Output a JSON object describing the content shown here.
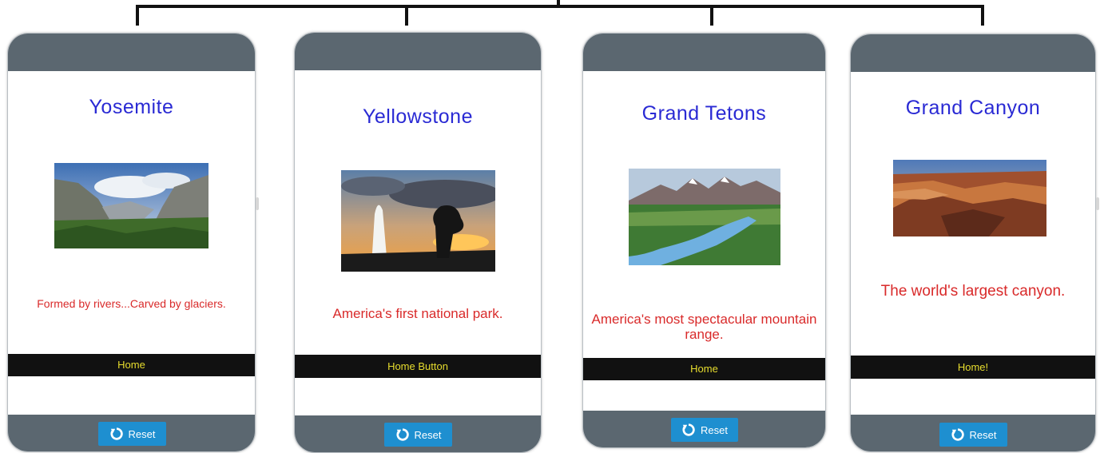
{
  "screens": [
    {
      "title": "Yosemite",
      "caption": "Formed by rivers...Carved by glaciers.",
      "home_label": "Home",
      "reset_label": "Reset",
      "image_icon": "yosemite-valley-photo"
    },
    {
      "title": "Yellowstone",
      "caption": "America's first national park.",
      "home_label": "Home Button",
      "reset_label": "Reset",
      "image_icon": "geyser-sunset-photo"
    },
    {
      "title": "Grand Tetons",
      "caption": "America's most spectacular mountain range.",
      "home_label": "Home",
      "reset_label": "Reset",
      "image_icon": "teton-river-photo"
    },
    {
      "title": "Grand Canyon",
      "caption": "The world's largest canyon.",
      "home_label": "Home!",
      "reset_label": "Reset",
      "image_icon": "canyon-photo"
    }
  ],
  "colors": {
    "frame": "#5b6770",
    "title": "#2a2ad4",
    "caption": "#d92a2a",
    "home_bar": "#111111",
    "home_text": "#e7dd2e",
    "reset_button": "#1e8fd0"
  }
}
